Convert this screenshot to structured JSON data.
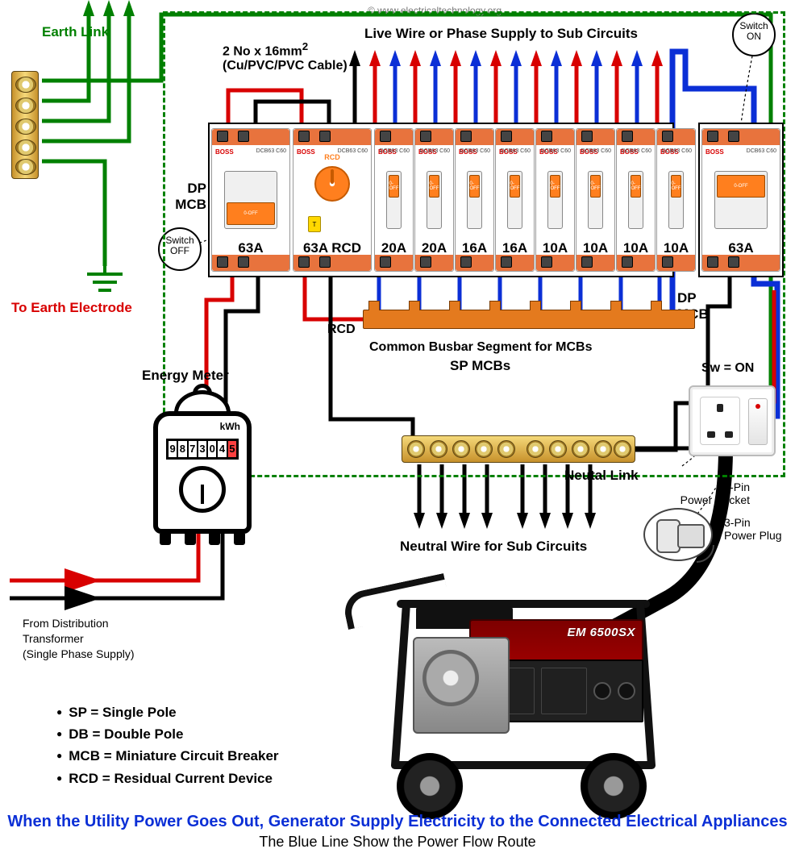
{
  "watermark": "© www.electricaltechnology.org",
  "labels": {
    "earth_link": "Earth Link",
    "to_earth_electrode": "To Earth Electrode",
    "cable_spec_1": "2 No x 16mm",
    "cable_spec_sup": "2",
    "cable_spec_2": "(Cu/PVC/PVC Cable)",
    "live_supply": "Live Wire or Phase Supply to Sub Circuits",
    "dp_mcb_left": "DP\nMCB",
    "dp_mcb_right": "DP\nMCB",
    "switch_off": "Switch\nOFF",
    "switch_on": "Switch\nON",
    "rcd": "RCD",
    "busbar_segment": "Common Busbar Segment for MCBs",
    "sp_mcbs": "SP MCBs",
    "neutral_link": "Neutal Link",
    "neutral_wire": "Neutral Wire for Sub Circuits",
    "sw_on": "Sw = ON",
    "socket": "3-Pin\nPower Socket",
    "plug": "3-Pin\nPower Plug",
    "energy_meter": "Energy Meter",
    "meter_unit": "kWh",
    "from_dist_1": "From Distribution",
    "from_dist_2": "Transformer",
    "from_dist_3": "(Single Phase Supply)"
  },
  "meter_reading": [
    "9",
    "8",
    "7",
    "3",
    "0",
    "4",
    "5"
  ],
  "breakers": [
    {
      "type": "dp",
      "label": "63A",
      "role": "main-dp-mcb",
      "pos": "left"
    },
    {
      "type": "rcd",
      "label": "63A RCD",
      "role": "rcd"
    },
    {
      "type": "sp",
      "label": "20A"
    },
    {
      "type": "sp",
      "label": "20A"
    },
    {
      "type": "sp",
      "label": "16A"
    },
    {
      "type": "sp",
      "label": "16A"
    },
    {
      "type": "sp",
      "label": "10A"
    },
    {
      "type": "sp",
      "label": "10A"
    },
    {
      "type": "sp",
      "label": "10A"
    },
    {
      "type": "sp",
      "label": "10A"
    }
  ],
  "gen_breaker": {
    "type": "dp",
    "label": "63A",
    "role": "gen-dp-mcb"
  },
  "brand": "BOSS",
  "toggle_text": "0-OFF",
  "rcd_body": "RCD",
  "rcd_test": "T",
  "generator_model": "EM 6500SX",
  "legend": [
    "SP = Single Pole",
    "DB = Double Pole",
    "MCB = Miniature Circuit Breaker",
    "RCD = Residual Current Device"
  ],
  "caption1": "When the Utility Power Goes Out, Generator Supply Electricity to the Connected Electrical Appliances",
  "caption2": "The Blue Line Show the Power Flow Route",
  "colors": {
    "live": "#d80000",
    "neutral": "#000000",
    "earth": "#008000",
    "genflow": "#0b2fd6"
  }
}
